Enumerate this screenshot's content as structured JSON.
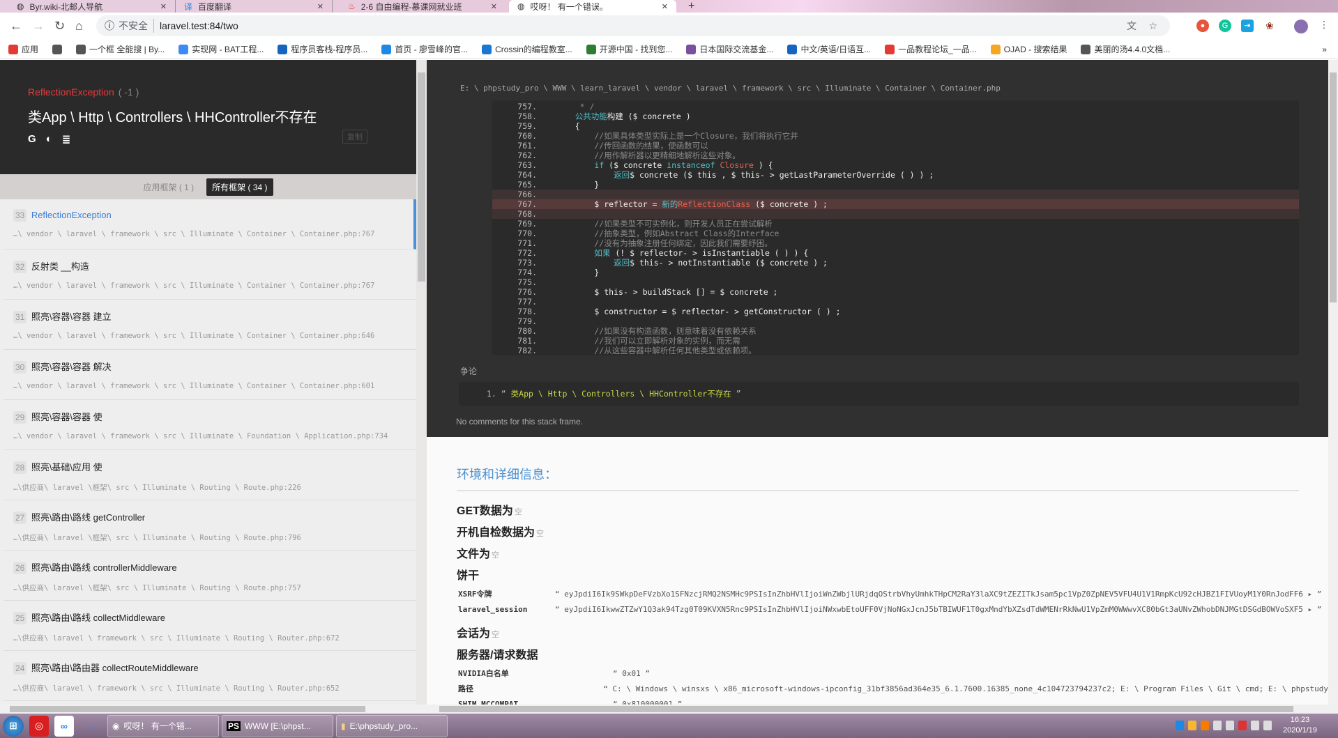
{
  "browser": {
    "tabs": [
      {
        "label": "Byr.wiki-北邮人导航",
        "active": false
      },
      {
        "label": "百度翻译",
        "active": false
      },
      {
        "label": "2-6 自由编程-慕课网就业班",
        "active": false
      },
      {
        "label": "哎呀！ 有一个错误。",
        "active": true
      }
    ],
    "security_label": "不安全",
    "url": "laravel.test:84/two",
    "bookmarks": [
      "应用",
      "",
      "一个框 全能搜 | By...",
      "实现网 - BAT工程...",
      "程序员客栈-程序员...",
      "首页 - 廖雪峰的官...",
      "Crossin的编程教室...",
      "开源中国 - 找到您...",
      "日本国际交流基金...",
      "中文/英语/日语互...",
      "一品教程论坛_一品...",
      "OJAD - 搜索结果",
      "美丽的汤4.4.0文档..."
    ],
    "bookmarks_more": "»"
  },
  "exception": {
    "name": "ReflectionException",
    "code": "( -1 )",
    "message": "类App \\ Http \\ Controllers \\ HHController不存在",
    "copy_label": "复制"
  },
  "frame_tabs": {
    "app": "应用框架 ( 1 )",
    "all": "所有框架 ( 34 )"
  },
  "frames": [
    {
      "num": "33",
      "cls": "ReflectionException",
      "path": "…\\ vendor \\ laravel \\ framework \\ src \\ Illuminate \\ Container \\ Container.php:767",
      "active": true
    },
    {
      "num": "32",
      "cls": "反射类 __构造",
      "path": "…\\ vendor \\ laravel \\ framework \\ src \\ Illuminate \\ Container \\ Container.php:767"
    },
    {
      "num": "31",
      "cls": "照亮\\容器\\容器 建立",
      "path": "…\\ vendor \\ laravel \\ framework \\ src \\ Illuminate \\ Container \\ Container.php:646"
    },
    {
      "num": "30",
      "cls": "照亮\\容器\\容器 解决",
      "path": "…\\ vendor \\ laravel \\ framework \\ src \\ Illuminate \\ Container \\ Container.php:601"
    },
    {
      "num": "29",
      "cls": "照亮\\容器\\容器 使",
      "path": "…\\ vendor \\ laravel \\ framework \\ src \\ Illuminate \\ Foundation \\ Application.php:734"
    },
    {
      "num": "28",
      "cls": "照亮\\基础\\应用 使",
      "path": "…\\供应商\\ laravel \\框架\\ src \\ Illuminate \\ Routing \\ Route.php:226"
    },
    {
      "num": "27",
      "cls": "照亮\\路由\\路线 getController",
      "path": "…\\供应商\\ laravel \\框架\\ src \\ Illuminate \\ Routing \\ Route.php:796"
    },
    {
      "num": "26",
      "cls": "照亮\\路由\\路线 controllerMiddleware",
      "path": "…\\供应商\\ laravel \\框架\\ src \\ Illuminate \\ Routing \\ Route.php:757"
    },
    {
      "num": "25",
      "cls": "照亮\\路由\\路线 collectMiddleware",
      "path": "…\\供应商\\ laravel \\ framework \\ src \\ Illuminate \\ Routing \\ Router.php:672"
    },
    {
      "num": "24",
      "cls": "照亮\\路由\\路由器 collectRouteMiddleware",
      "path": "…\\供应商\\ laravel \\ framework \\ src \\ Illuminate \\ Routing \\ Router.php:652"
    }
  ],
  "code": {
    "file": "E: \\ phpstudy_pro \\ WWW \\ learn_laravel \\ vendor \\ laravel \\ framework \\ src \\ Illuminate \\ Container \\ Container.php",
    "current_line": 767,
    "lines": [
      {
        "n": "757.",
        "s": [
          [
            "     * /",
            "cm"
          ]
        ]
      },
      {
        "n": "758.",
        "s": [
          [
            "    ",
            ""
          ],
          [
            "公共功能",
            "k"
          ],
          [
            "构建 ($ concrete )",
            ""
          ]
        ]
      },
      {
        "n": "759.",
        "s": [
          [
            "    {",
            ""
          ]
        ]
      },
      {
        "n": "760.",
        "s": [
          [
            "        //如果具体类型实际上是一个Closure，我们将执行它并",
            "cm"
          ]
        ]
      },
      {
        "n": "761.",
        "s": [
          [
            "        //传回函数的结果，使函数可以",
            "cm"
          ]
        ]
      },
      {
        "n": "762.",
        "s": [
          [
            "        //用作解析器以更精细地解析这些对象。",
            "cm"
          ]
        ]
      },
      {
        "n": "763.",
        "s": [
          [
            "        ",
            ""
          ],
          [
            "if",
            "k"
          ],
          [
            " ($ concrete ",
            ""
          ],
          [
            "instanceof",
            "k"
          ],
          [
            " ",
            ""
          ],
          [
            "Closure",
            "r"
          ],
          [
            " ) {",
            ""
          ]
        ]
      },
      {
        "n": "764.",
        "s": [
          [
            "            ",
            ""
          ],
          [
            "返回",
            "k"
          ],
          [
            "$ concrete ($ this , $ this- > getLastParameterOverride ( ) ) ;",
            ""
          ]
        ]
      },
      {
        "n": "765.",
        "s": [
          [
            "        }",
            ""
          ]
        ]
      },
      {
        "n": "766.",
        "s": [
          [
            "",
            ""
          ]
        ],
        "hl": true
      },
      {
        "n": "767.",
        "s": [
          [
            "        $ reflector = ",
            ""
          ],
          [
            "新的",
            "k"
          ],
          [
            "ReflectionClass",
            "r"
          ],
          [
            " ($ concrete ) ;",
            ""
          ]
        ],
        "cur": true
      },
      {
        "n": "768.",
        "s": [
          [
            "",
            ""
          ]
        ],
        "hl": true
      },
      {
        "n": "769.",
        "s": [
          [
            "        //如果类型不可实例化，则开发人员正在尝试解析",
            "cm"
          ]
        ]
      },
      {
        "n": "770.",
        "s": [
          [
            "        //抽象类型，例如Abstract Class的Interface",
            "cm"
          ]
        ]
      },
      {
        "n": "771.",
        "s": [
          [
            "        //没有为抽象注册任何绑定，因此我们需要纾困。",
            "cm"
          ]
        ]
      },
      {
        "n": "772.",
        "s": [
          [
            "        ",
            ""
          ],
          [
            "如果",
            "k"
          ],
          [
            " (! $ reflector- > isInstantiable ( ) ) {",
            ""
          ]
        ]
      },
      {
        "n": "773.",
        "s": [
          [
            "            ",
            ""
          ],
          [
            "返回",
            "k"
          ],
          [
            "$ this- > notInstantiable ($ concrete ) ;",
            ""
          ]
        ]
      },
      {
        "n": "774.",
        "s": [
          [
            "        }",
            ""
          ]
        ]
      },
      {
        "n": "775.",
        "s": [
          [
            "",
            ""
          ]
        ]
      },
      {
        "n": "776.",
        "s": [
          [
            "        $ this- > buildStack [] = $ concrete ;",
            ""
          ]
        ]
      },
      {
        "n": "777.",
        "s": [
          [
            "",
            ""
          ]
        ]
      },
      {
        "n": "778.",
        "s": [
          [
            "        $ constructor = $ reflector- > getConstructor ( ) ;",
            ""
          ]
        ]
      },
      {
        "n": "779.",
        "s": [
          [
            "",
            ""
          ]
        ]
      },
      {
        "n": "780.",
        "s": [
          [
            "        //如果没有构造函数，则意味着没有依赖关系",
            "cm"
          ]
        ]
      },
      {
        "n": "781.",
        "s": [
          [
            "        //我们可以立即解析对象的实例，而无需",
            "cm"
          ]
        ]
      },
      {
        "n": "782.",
        "s": [
          [
            "        //从这些容器中解析任何其他类型或依赖项。",
            "cm"
          ]
        ]
      }
    ]
  },
  "arguments": {
    "label": "争论",
    "items": [
      {
        "index": "1.",
        "open": "“",
        "value": "类App \\ Http \\ Controllers \\ HHController不存在",
        "close": "”"
      }
    ]
  },
  "no_comments": "No comments for this stack frame.",
  "env": {
    "title": "环境和详细信息：",
    "empty": "空",
    "get": "GET数据为",
    "post": "开机自检数据为",
    "files": "文件为",
    "cookies": "饼干",
    "cookie_rows": [
      {
        "k": "XSRF令牌",
        "v": "“ eyJpdiI6Ik9SWkpDeFVzbXo1SFNzcjRMQ2NSMHc9PSIsInZhbHVlIjoiWnZWbjlURjdqOStrbVhyUmhkTHpCM2RaY3laXC9tZEZITkJsam5pc1VpZ0ZpNEV5VFU4U1V1RmpKcU92cHJBZ1FIVUoyM1Y0RnJodFF6 ▸ ”"
      },
      {
        "k": "laravel_session",
        "v": "“ eyJpdiI6IkwwZTZwY1Q3ak94Tzg0T09KVXN5Rnc9PSIsInZhbHVlIjoiNWxwbEtoUFF0VjNoNGxJcnJ5bTBIWUF1T0gxMndYbXZsdTdWMENrRkNwU1VpZmM0WWwvXC80bGt3aUNvZWhobDNJMGtDSGdBOWVoSXF5 ▸ ”"
      }
    ],
    "session": "会话为",
    "server": "服务器/请求数据",
    "server_rows": [
      {
        "k": "NVIDIA白名单",
        "v": "“ 0x01 ”"
      },
      {
        "k": "路径",
        "v": "“ C: \\ Windows \\ winsxs \\ x86_microsoft-windows-ipconfig_31bf3856ad364e35_6.1.7600.16385_none_4c104723794237c2; E: \\ Program Files \\ Git \\ cmd; E: \\ phpstudy"
      },
      {
        "k": "SHIM_MCCOMPAT",
        "v": "“ 0x810000001 ”"
      }
    ]
  },
  "taskbar": {
    "windows": [
      "哎呀！ 有一个错...",
      "WWW [E:\\phpst...",
      "E:\\phpstudy_pro..."
    ],
    "time": "16:23",
    "date": "2020/1/19"
  },
  "colors": {
    "accent": "#4a8fd8",
    "exception": "#e63a3a",
    "keyword": "#4fc1c8",
    "string": "#c8d644"
  }
}
